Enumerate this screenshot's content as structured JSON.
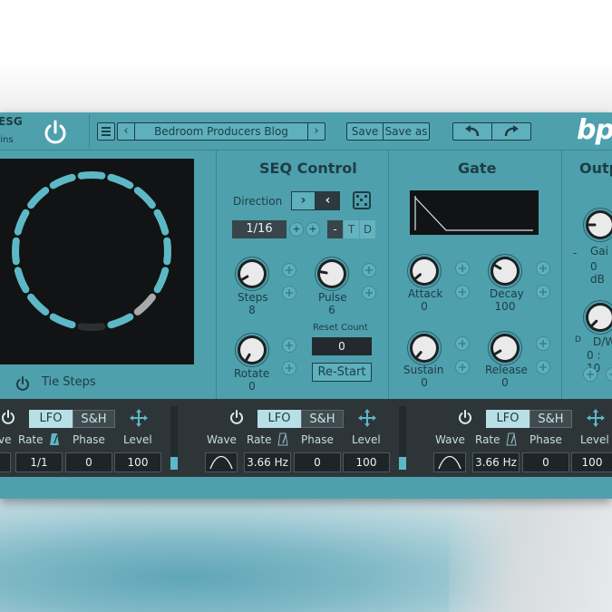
{
  "header": {
    "brand_name": "ESG",
    "brand_sub": "gins",
    "preset_name": "Bedroom Producers Blog",
    "prev_label": "‹",
    "next_label": "›",
    "save_label": "Save",
    "save_as_label": "Save as",
    "logo_text": "bp"
  },
  "tie_steps": {
    "label": "Tie Steps"
  },
  "seq": {
    "title": "SEQ Control",
    "direction_label": "Direction",
    "dir_forward": "›",
    "dir_backward": "‹",
    "rate": "1/16",
    "seg_minus": "-",
    "seg_t": "T",
    "seg_d": "D",
    "steps_label": "Steps",
    "steps_value": "8",
    "pulse_label": "Pulse",
    "pulse_value": "6",
    "rotate_label": "Rotate",
    "rotate_value": "0",
    "reset_count_label": "Reset Count",
    "reset_count_value": "0",
    "restart_label": "Re-Start"
  },
  "gate": {
    "title": "Gate",
    "attack_label": "Attack",
    "attack_value": "0",
    "decay_label": "Decay",
    "decay_value": "100",
    "sustain_label": "Sustain",
    "sustain_value": "0",
    "release_label": "Release",
    "release_value": "0"
  },
  "output": {
    "title": "Outp",
    "gain_label": "Gai",
    "gain_value": "0 dB",
    "gain_minus": "-",
    "dw_label": "D/W",
    "dw_value": "0 : 10",
    "dw_d": "D"
  },
  "lfos": [
    {
      "lfo_label": "LFO",
      "sh_label": "S&H",
      "wave_label": "ve",
      "rate_label": "Rate",
      "phase_label": "Phase",
      "level_label": "Level",
      "rate_value": "1/1",
      "phase_value": "0",
      "level_value": "100"
    },
    {
      "lfo_label": "LFO",
      "sh_label": "S&H",
      "wave_label": "Wave",
      "rate_label": "Rate",
      "phase_label": "Phase",
      "level_label": "Level",
      "rate_value": "3.66 Hz",
      "phase_value": "0",
      "level_value": "100"
    },
    {
      "lfo_label": "LFO",
      "sh_label": "S&H",
      "wave_label": "Wave",
      "rate_label": "Rate",
      "phase_label": "Phase",
      "level_label": "Level",
      "rate_value": "3.66 Hz",
      "phase_value": "0",
      "level_value": "100"
    }
  ],
  "sequencer_ring": {
    "total_steps": 16,
    "active_steps": [
      1,
      2,
      3,
      4,
      5,
      6,
      7,
      9,
      11,
      12,
      13,
      14,
      15,
      16
    ],
    "highlighted_steps": [
      8
    ],
    "dim_steps": [
      10
    ]
  },
  "colors": {
    "panel": "#4ea0ad",
    "accent": "#5db8c6",
    "display_bg": "#111314",
    "text_dark": "#1f3c44"
  },
  "icons": {
    "power": "power-icon",
    "menu": "menu-icon",
    "undo": "undo-icon",
    "redo": "redo-icon",
    "dice": "dice-icon",
    "plus": "plus-icon",
    "move": "move-icon",
    "metronome": "metronome-icon"
  }
}
